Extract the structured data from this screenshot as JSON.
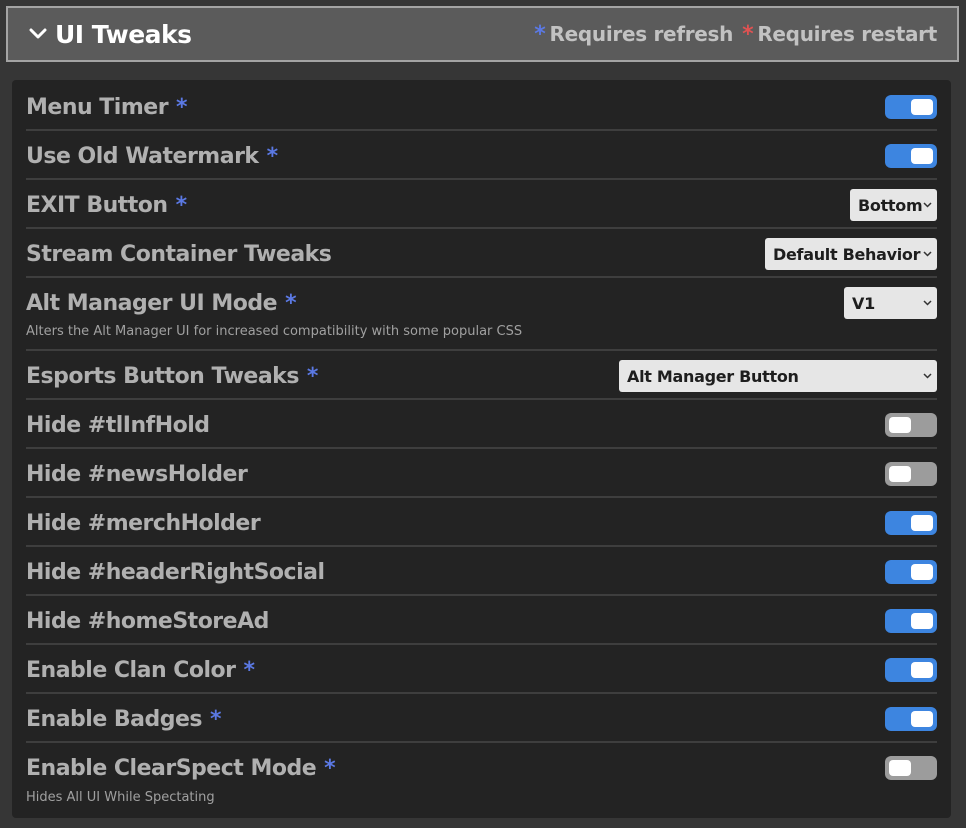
{
  "header": {
    "title": "UI Tweaks",
    "legend_asterisk": "*",
    "legend_refresh": "Requires refresh",
    "legend_restart": "Requires restart"
  },
  "colors": {
    "refresh_asterisk": "#5b79e4",
    "restart_asterisk": "#e05252",
    "toggle_on": "#3d85e0",
    "toggle_off": "#9c9c9c"
  },
  "settings": [
    {
      "label": "Menu Timer",
      "asterisk": "*",
      "control": "toggle",
      "state": "on"
    },
    {
      "label": "Use Old Watermark",
      "asterisk": "*",
      "control": "toggle",
      "state": "on"
    },
    {
      "label": "EXIT Button",
      "asterisk": "*",
      "control": "select",
      "value": "Bottom"
    },
    {
      "label": "Stream Container Tweaks",
      "asterisk": "",
      "control": "select",
      "value": "Default Behavior"
    },
    {
      "label": "Alt Manager UI Mode",
      "asterisk": "*",
      "control": "select",
      "value": "V1",
      "description": "Alters the Alt Manager UI for increased compatibility with some popular CSS"
    },
    {
      "label": "Esports Button Tweaks",
      "asterisk": "*",
      "control": "select",
      "value": "Alt Manager Button"
    },
    {
      "label": "Hide #tlInfHold",
      "asterisk": "",
      "control": "toggle",
      "state": "off"
    },
    {
      "label": "Hide #newsHolder",
      "asterisk": "",
      "control": "toggle",
      "state": "off"
    },
    {
      "label": "Hide #merchHolder",
      "asterisk": "",
      "control": "toggle",
      "state": "on"
    },
    {
      "label": "Hide #headerRightSocial",
      "asterisk": "",
      "control": "toggle",
      "state": "on"
    },
    {
      "label": "Hide #homeStoreAd",
      "asterisk": "",
      "control": "toggle",
      "state": "on"
    },
    {
      "label": "Enable Clan Color",
      "asterisk": "*",
      "control": "toggle",
      "state": "on"
    },
    {
      "label": "Enable Badges",
      "asterisk": "*",
      "control": "toggle",
      "state": "on"
    },
    {
      "label": "Enable ClearSpect Mode",
      "asterisk": "*",
      "control": "toggle",
      "state": "off",
      "description": "Hides All UI While Spectating"
    }
  ]
}
